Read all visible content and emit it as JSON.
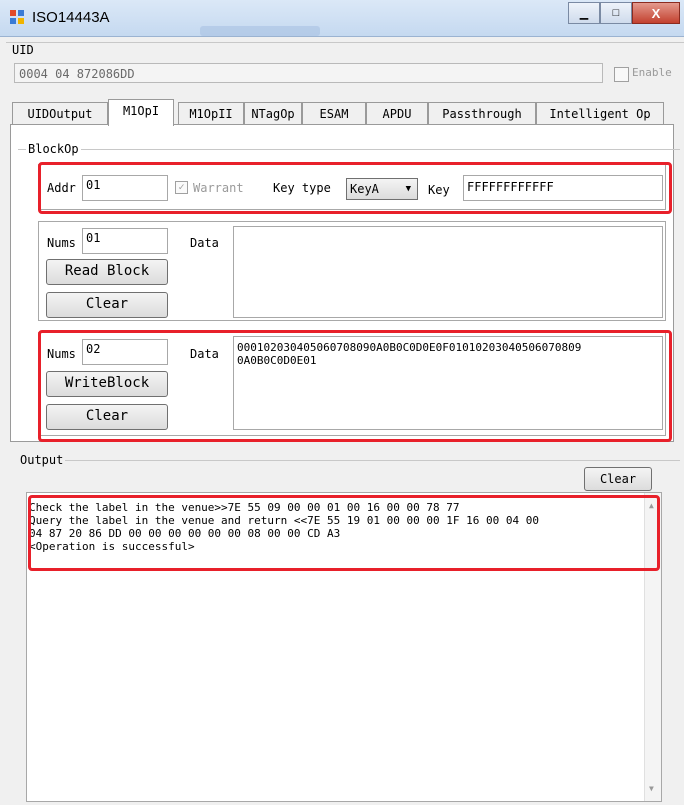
{
  "window": {
    "title": "ISO14443A",
    "min_glyph": "▁",
    "max_glyph": "□",
    "close_glyph": "X"
  },
  "uid": {
    "label": "UID",
    "value": "0004 04 872086DD",
    "enable_label": "Enable"
  },
  "tabs": [
    {
      "label": "UIDOutput"
    },
    {
      "label": "M1OpI"
    },
    {
      "label": "M1OpII"
    },
    {
      "label": "NTagOp"
    },
    {
      "label": "ESAM"
    },
    {
      "label": "APDU"
    },
    {
      "label": "Passthrough"
    },
    {
      "label": "Intelligent Op"
    }
  ],
  "blockop": {
    "label": "BlockOp",
    "addr_label": "Addr",
    "addr_value": "01",
    "warrant_label": "Warrant",
    "keytype_label": "Key type",
    "keytype_value": "KeyA",
    "key_label": "Key",
    "key_value": "FFFFFFFFFFFF"
  },
  "read": {
    "nums_label": "Nums",
    "nums_value": "01",
    "data_label": "Data",
    "read_button": "Read Block",
    "clear_button": "Clear"
  },
  "write": {
    "nums_label": "Nums",
    "nums_value": "02",
    "data_label": "Data",
    "data_line1": "000102030405060708090A0B0C0D0E0F01010203040506070809",
    "data_line2": "0A0B0C0D0E01",
    "write_button": "WriteBlock",
    "clear_button": "Clear"
  },
  "output": {
    "label": "Output",
    "clear_button": "Clear",
    "lines": [
      "Check the label in the venue>>7E 55 09 00 00 01 00 16 00 00 78 77",
      "Query the label in the venue and return <<7E 55 19 01 00 00 00 1F 16 00 04 00",
      "04 87 20 86 DD 00 00 00 00 00 00 08 00 00 CD A3",
      "<Operation is successful>"
    ]
  },
  "colors": {
    "highlight": "#e8202a"
  }
}
